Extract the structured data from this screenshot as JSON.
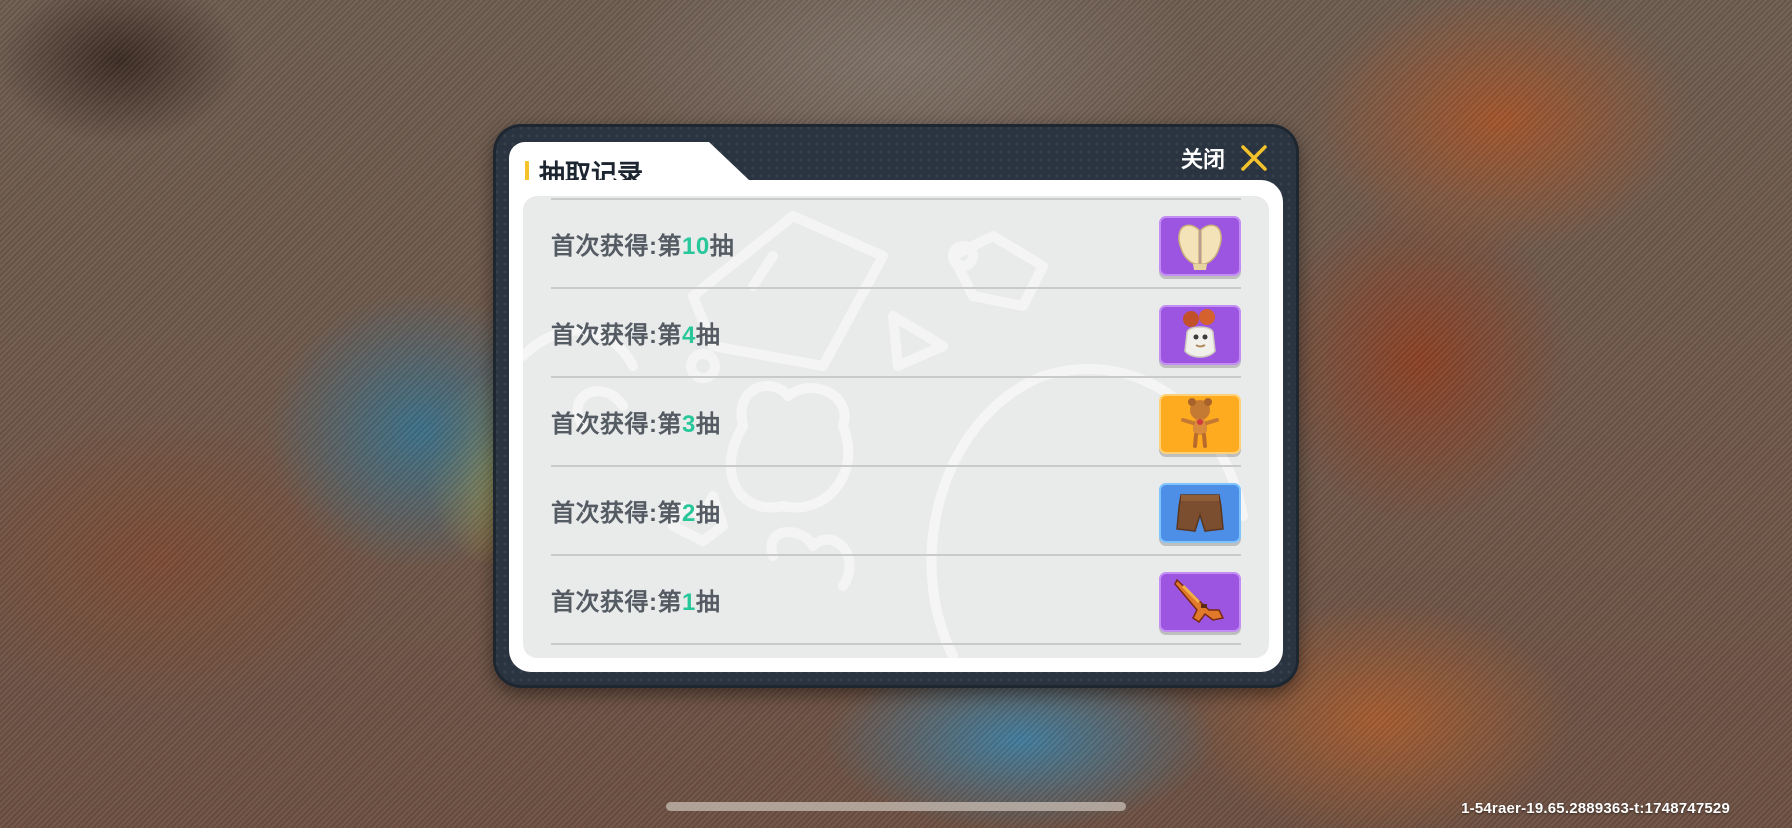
{
  "dialog": {
    "title": "抽取记录",
    "close_label": "关闭"
  },
  "records": [
    {
      "prefix": "首次获得:第",
      "number": "10",
      "suffix": "抽",
      "item_icon": "gloves-icon",
      "rarity_color": "#9b55e0"
    },
    {
      "prefix": "首次获得:第",
      "number": "4",
      "suffix": "抽",
      "item_icon": "balloon-hat-icon",
      "rarity_color": "#9b55e0"
    },
    {
      "prefix": "首次获得:第",
      "number": "3",
      "suffix": "抽",
      "item_icon": "teddy-figure-icon",
      "rarity_color": "#ffab1f"
    },
    {
      "prefix": "首次获得:第",
      "number": "2",
      "suffix": "抽",
      "item_icon": "shorts-icon",
      "rarity_color": "#4d8fe6"
    },
    {
      "prefix": "首次获得:第",
      "number": "1",
      "suffix": "抽",
      "item_icon": "rifle-icon",
      "rarity_color": "#9b55e0"
    }
  ],
  "footer": {
    "debug_text": "1-54raer-19.65.2889363-t:1748747529"
  }
}
